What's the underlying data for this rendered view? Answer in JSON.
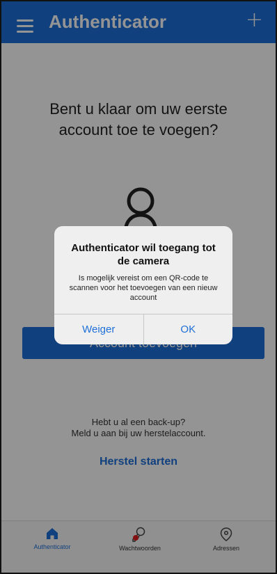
{
  "header": {
    "title": "Authenticator",
    "menu_icon": "hamburger-menu-icon",
    "add_icon": "plus-icon",
    "add_symbol": "+"
  },
  "main": {
    "headline": "Bent u klaar om uw eerste account toe te voegen?",
    "add_account_label": "Account toevoegen",
    "backup_line1": "Hebt u al een back-up?",
    "backup_line2": "Meld u aan bij uw herstelaccount.",
    "restore_label": "Herstel starten"
  },
  "dialog": {
    "title": "Authenticator wil toegang tot de camera",
    "message": "Is mogelijk vereist om een QR-code te scannen voor het toevoegen van een nieuw account",
    "deny_label": "Weiger",
    "ok_label": "OK"
  },
  "tabs": [
    {
      "label": "Authenticator",
      "icon": "home-icon",
      "active": true
    },
    {
      "label": "Wachtwoorden",
      "icon": "key-icon",
      "active": false
    },
    {
      "label": "Adressen",
      "icon": "location-pin-icon",
      "active": false
    }
  ],
  "colors": {
    "accent": "#1e6fd9",
    "overlay": "rgba(0,0,0,0.42)",
    "dialog_bg": "#efefef",
    "badge": "#e02020"
  }
}
